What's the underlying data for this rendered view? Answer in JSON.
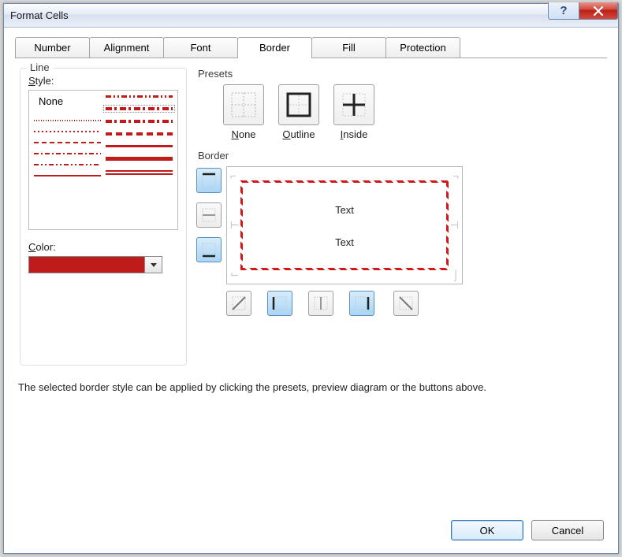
{
  "window": {
    "title": "Format Cells"
  },
  "tabs": {
    "number": "Number",
    "alignment": "Alignment",
    "font": "Font",
    "border": "Border",
    "fill": "Fill",
    "protection": "Protection",
    "active": "border"
  },
  "line": {
    "group": "Line",
    "style_label_pre": "S",
    "style_label_post": "tyle:",
    "none": "None",
    "color_label_pre": "C",
    "color_label_post": "olor:",
    "color_value": "#bf1b1b"
  },
  "presets": {
    "group": "Presets",
    "none_pre": "N",
    "none_post": "one",
    "outline_pre": "O",
    "outline_post": "utline",
    "inside_pre": "I",
    "inside_post": "nside"
  },
  "border": {
    "group": "Border",
    "preview_text1": "Text",
    "preview_text2": "Text"
  },
  "hint": "The selected border style can be applied by clicking the presets, preview diagram or the buttons above.",
  "footer": {
    "ok": "OK",
    "cancel": "Cancel"
  }
}
